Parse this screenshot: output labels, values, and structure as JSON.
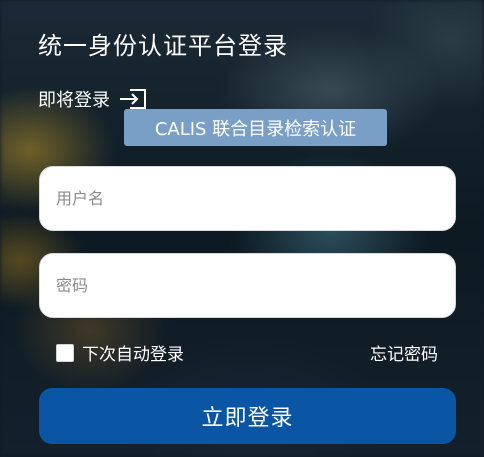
{
  "header": {
    "title": "统一身份认证平台登录"
  },
  "login_soon": {
    "label": "即将登录",
    "icon": "login-arrow-icon"
  },
  "calis_badge": {
    "label": "CALIS 联合目录检索认证"
  },
  "form": {
    "username_placeholder": "用户名",
    "username_value": "",
    "password_placeholder": "密码",
    "password_value": "",
    "remember_label": "下次自动登录",
    "remember_checked": false,
    "forgot_label": "忘记密码",
    "submit_label": "立即登录"
  },
  "colors": {
    "badge_bg": "#7a9fc6",
    "submit_bg": "#0a56a4",
    "text": "#ffffff"
  }
}
